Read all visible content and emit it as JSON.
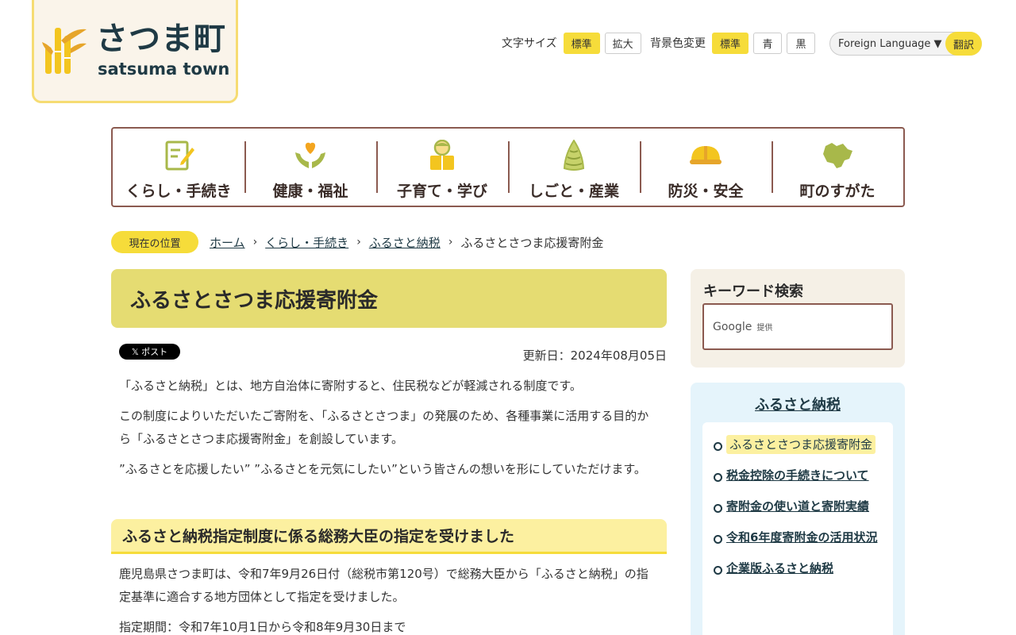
{
  "logo": {
    "jp": "さつま町",
    "en": "satsuma town"
  },
  "utility": {
    "font_size_label": "文字サイズ",
    "font_standard": "標準",
    "font_large": "拡大",
    "bg_label": "背景色変更",
    "bg_standard": "標準",
    "bg_blue": "青",
    "bg_black": "黒",
    "language_select": "Foreign Language ▼",
    "translate": "翻訳"
  },
  "global_nav": [
    {
      "label": "くらし・手続き",
      "icon": "document-pen-icon"
    },
    {
      "label": "健康・福祉",
      "icon": "heart-hands-icon"
    },
    {
      "label": "子育て・学び",
      "icon": "child-reading-icon"
    },
    {
      "label": "しごと・産業",
      "icon": "bamboo-shoot-icon"
    },
    {
      "label": "防災・安全",
      "icon": "helmet-icon"
    },
    {
      "label": "町のすがた",
      "icon": "town-map-icon"
    }
  ],
  "breadcrumb": {
    "here_label": "現在の位置",
    "items": [
      "ホーム",
      "くらし・手続き",
      "ふるさと納税"
    ],
    "current": "ふるさとさつま応援寄附金"
  },
  "main": {
    "title": "ふるさとさつま応援寄附金",
    "post_button": "𝕏 ポスト",
    "updated": "更新日：2024年08月05日",
    "paragraphs": [
      "「ふるさと納税」とは、地方自治体に寄附すると、住民税などが軽減される制度です。",
      "この制度によりいただいたご寄附を、「ふるさとさつま」の発展のため、各種事業に活用する目的から「ふるさとさつま応援寄附金」を創設しています。",
      "”ふるさとを応援したい” ”ふるさとを元気にしたい”という皆さんの想いを形にしていただけます。"
    ],
    "heading2": "ふるさと納税指定制度に係る総務大臣の指定を受けました",
    "paragraphs2": [
      "鹿児島県さつま町は、令和7年9月26日付（総税市第120号）で総務大臣から「ふるさと納税」の指定基準に適合する地方団体として指定を受けました。",
      "指定期間：令和7年10月1日から令和8年9月30日まで"
    ]
  },
  "sidebar": {
    "search_title": "キーワード検索",
    "search_brand": "Google",
    "search_provided": "提供",
    "section_title": "ふるさと納税",
    "links": [
      "ふるさとさつま応援寄附金",
      "税金控除の手続きについて",
      "寄附金の使い道と寄附実績",
      "令和6年度寄附金の活用状況",
      "企業版ふるさと納税"
    ]
  },
  "colors": {
    "accent_yellow": "#f6dc3a",
    "nav_border": "#8b5a50",
    "title_bg": "#e5dc72",
    "side_bg": "#e5f4fb"
  }
}
